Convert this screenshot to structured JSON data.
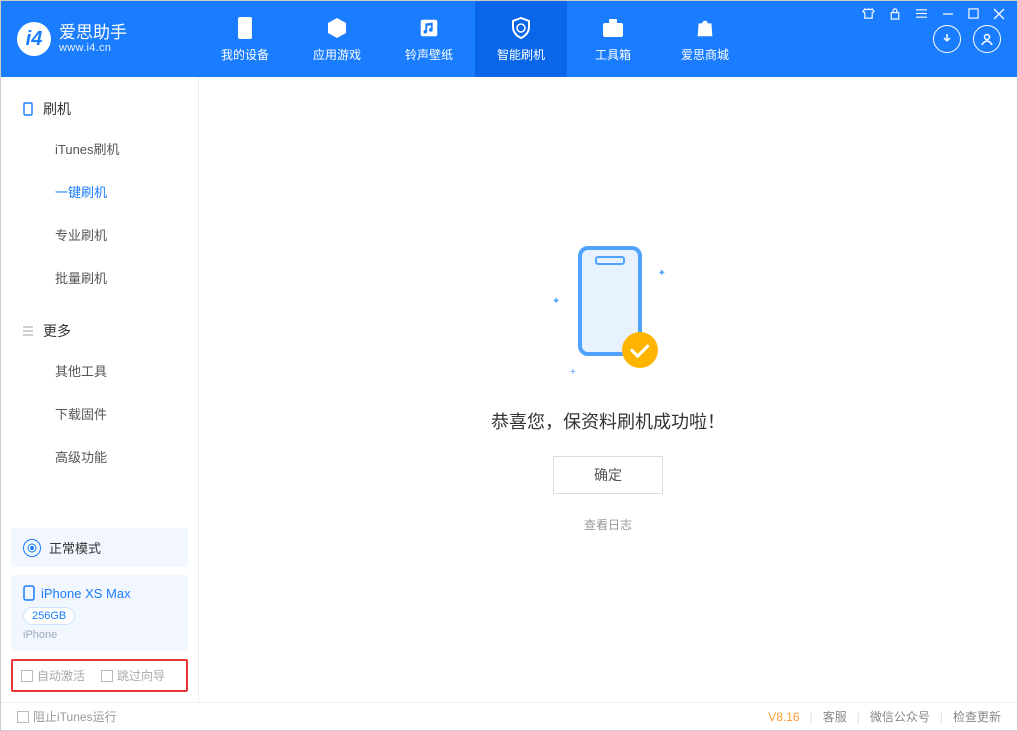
{
  "app": {
    "name": "爱思助手",
    "url": "www.i4.cn"
  },
  "nav": {
    "items": [
      {
        "label": "我的设备"
      },
      {
        "label": "应用游戏"
      },
      {
        "label": "铃声壁纸"
      },
      {
        "label": "智能刷机"
      },
      {
        "label": "工具箱"
      },
      {
        "label": "爱思商城"
      }
    ]
  },
  "sidebar": {
    "section1": {
      "title": "刷机",
      "items": [
        "iTunes刷机",
        "一键刷机",
        "专业刷机",
        "批量刷机"
      ],
      "activeIndex": 1
    },
    "section2": {
      "title": "更多",
      "items": [
        "其他工具",
        "下载固件",
        "高级功能"
      ]
    },
    "mode": "正常模式",
    "device": {
      "name": "iPhone XS Max",
      "storage": "256GB",
      "type": "iPhone"
    },
    "options": {
      "autoActivate": "自动激活",
      "skipGuide": "跳过向导"
    }
  },
  "main": {
    "successMessage": "恭喜您，保资料刷机成功啦！",
    "confirmLabel": "确定",
    "viewLogLabel": "查看日志"
  },
  "footer": {
    "blockItunes": "阻止iTunes运行",
    "version": "V8.16",
    "links": [
      "客服",
      "微信公众号",
      "检查更新"
    ]
  }
}
